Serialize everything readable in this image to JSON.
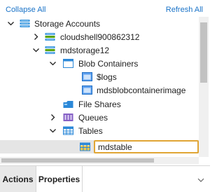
{
  "toolbar": {
    "collapse_all": "Collapse All",
    "refresh_all": "Refresh All"
  },
  "tree": {
    "storage_accounts": "Storage Accounts",
    "cloudshell": "cloudshell900862312",
    "mdstorage": "mdstorage12",
    "blob_containers": "Blob Containers",
    "logs": "$logs",
    "mdsblob": "mdsblobcontainerimage",
    "file_shares": "File Shares",
    "queues": "Queues",
    "tables": "Tables"
  },
  "rename": {
    "value": "mdstable"
  },
  "tabs": {
    "actions": "Actions",
    "properties": "Properties"
  },
  "colors": {
    "accent": "#1a73c8",
    "rename_border": "#e0a534",
    "selected_row": "#e5e5e5"
  }
}
